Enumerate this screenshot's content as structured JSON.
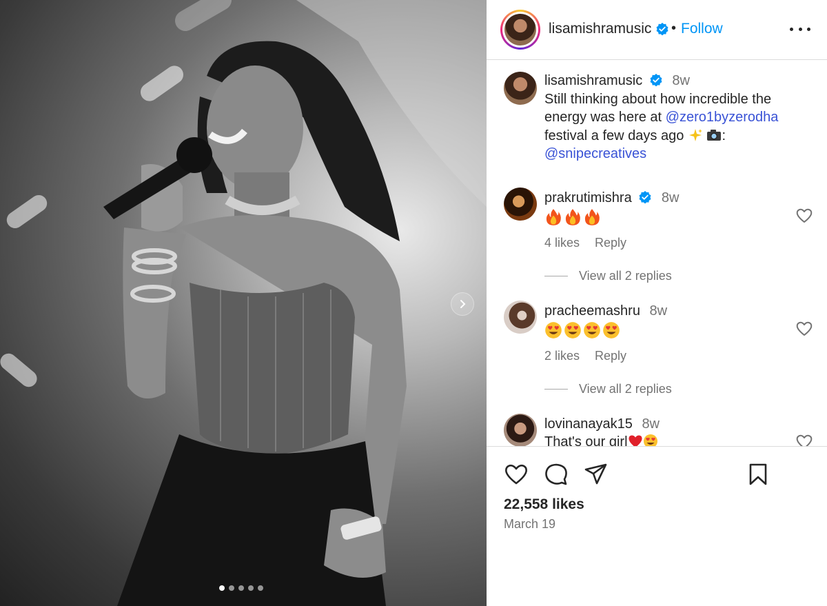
{
  "post": {
    "author": "lisamishramusic",
    "separator": "•",
    "follow_label": "Follow",
    "caption": {
      "time": "8w",
      "text_1": "Still thinking about how incredible the energy was here at ",
      "mention_1": "@zero1byzerodha",
      "text_2": " festival a few days ago ",
      "text_3": ": ",
      "mention_2": "@snipecreatives",
      "emoji": [
        "sparkles-emoji",
        "camera-emoji"
      ]
    },
    "carousel": {
      "slides": 5,
      "active": 0
    },
    "likes": "22,558 likes",
    "date": "March 19"
  },
  "comments": [
    {
      "user": "prakrutimishra",
      "verified": true,
      "time": "8w",
      "emoji": [
        "fire-emoji",
        "fire-emoji",
        "fire-emoji"
      ],
      "likes": "4 likes",
      "reply_label": "Reply",
      "view_replies": "View all 2 replies"
    },
    {
      "user": "pracheemashru",
      "verified": false,
      "time": "8w",
      "emoji": [
        "heart-eyes-emoji",
        "heart-eyes-emoji",
        "heart-eyes-emoji",
        "heart-eyes-emoji"
      ],
      "likes": "2 likes",
      "reply_label": "Reply",
      "view_replies": "View all 2 replies"
    },
    {
      "user": "lovinanayak15",
      "verified": false,
      "time": "8w",
      "text": "That's our girl",
      "emoji": [
        "red-heart-emoji",
        "heart-eyes-emoji"
      ]
    }
  ],
  "icons": {
    "verified": "verified-badge-icon",
    "more": "more-options-icon",
    "like": "heart-icon",
    "comment": "comment-icon",
    "share": "share-icon",
    "save": "bookmark-icon",
    "next": "chevron-right-icon"
  },
  "colors": {
    "follow": "#0095f6",
    "mention": "#3a53d6",
    "verified": "#0095f6",
    "muted": "#737373",
    "divider": "#dbdbdb"
  }
}
